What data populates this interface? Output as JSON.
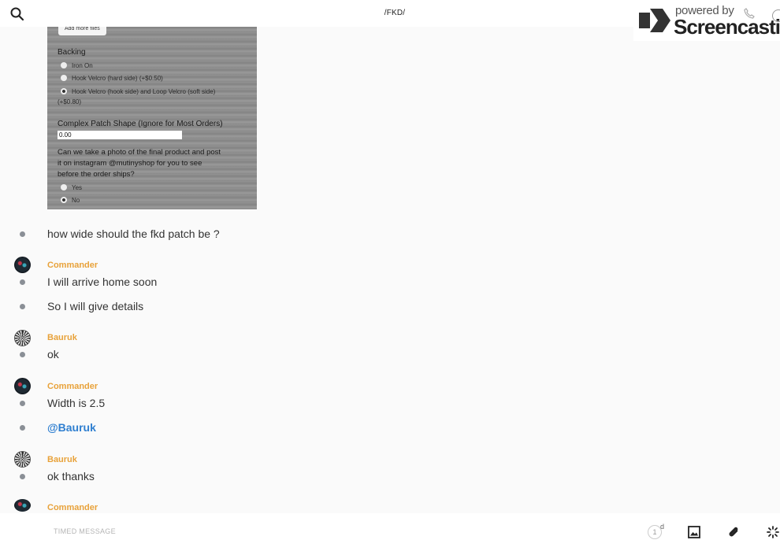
{
  "header": {
    "channel": "/FKD/"
  },
  "watermark": {
    "powered": "powered by",
    "brand": "Screencastify"
  },
  "attachment": {
    "add_files": "Add more files",
    "backing_title": "Backing",
    "options": [
      "Iron On",
      "Hook Velcro (hard side) (+$0.50)",
      "Hook Velcro (hook side) and Loop Velcro (soft side)",
      "(+$0.80)"
    ],
    "complex_title": "Complex Patch Shape (Ignore for Most Orders)",
    "complex_value": "0.00",
    "photo_q1": "Can we take a photo of the final product and post",
    "photo_q2": "it on instagram @mutinyshop for you to see",
    "photo_q3": "before the order ships?",
    "yes": "Yes",
    "no": "No"
  },
  "messages": [
    {
      "text": "how wide should the fkd patch be ?"
    },
    {
      "author": "Commander",
      "text": "I will arrive home soon"
    },
    {
      "text": "So I will give details"
    },
    {
      "author": "Bauruk",
      "text": "ok"
    },
    {
      "author": "Commander",
      "text": "Width is 2.5"
    },
    {
      "text": "@Bauruk"
    },
    {
      "author": "Bauruk",
      "text": "ok thanks"
    },
    {
      "author": "Commander"
    }
  ],
  "composer": {
    "placeholder": "TIMED MESSAGE",
    "timer_value": "1",
    "timer_unit": "d"
  },
  "colors": {
    "author": "#e8a23a",
    "mention": "#2f7fd0",
    "bullet": "#8a8f96"
  },
  "icons": [
    "search-icon",
    "phone-icon",
    "info-icon",
    "timer-icon",
    "image-icon",
    "paperclip-icon",
    "spinner-icon"
  ]
}
